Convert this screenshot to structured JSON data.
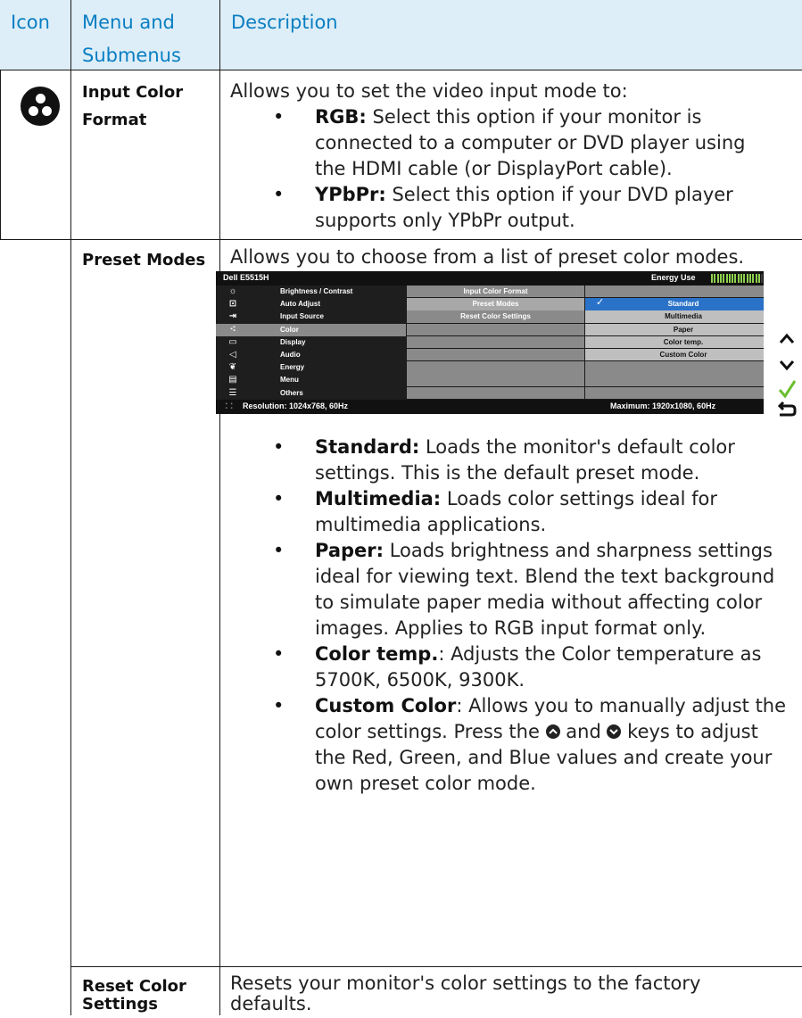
{
  "header": {
    "col_icon": "Icon",
    "col_menu_line1": "Menu and",
    "col_menu_line2": "Submenus",
    "col_desc": "Description"
  },
  "rows": {
    "input_color_format": {
      "label_line1": "Input Color",
      "label_line2": "Format",
      "intro": "Allows you to set the video input mode to:",
      "bullets": [
        {
          "term": "RGB:",
          "line1": " Select this option if your monitor is",
          "line2": "connected to a computer or DVD player using",
          "line3": "the HDMI cable (or DisplayPort cable)."
        },
        {
          "term": "YPbPr:",
          "line1": " Select this option if your DVD player",
          "line2": "supports only YPbPr output."
        }
      ]
    },
    "preset_modes": {
      "label": "Preset Modes",
      "intro": "Allows you to choose from a list of preset color modes.",
      "bullets": [
        {
          "term": "Standard:",
          "lines": [
            " Loads the monitor's default color",
            "settings. This is the default preset mode."
          ]
        },
        {
          "term": "Multimedia:",
          "lines": [
            " Loads color settings ideal for",
            "multimedia applications."
          ]
        },
        {
          "term": "Paper:",
          "lines": [
            " Loads brightness and sharpness settings",
            "ideal for viewing text. Blend the text background",
            "to simulate paper media without affecting color",
            "images. Applies to RGB input format only."
          ]
        },
        {
          "term": "Color temp.",
          "lines": [
            ": Adjusts the Color temperature as",
            "5700K, 6500K, 9300K."
          ]
        },
        {
          "term": "Custom Color",
          "lines": [
            ": Allows you to manually adjust the"
          ]
        }
      ],
      "custom_color_line2a": "color settings. Press the",
      "custom_color_line2b": "and",
      "custom_color_line2c": "keys to adjust",
      "custom_color_line3": "the Red, Green, and Blue values and create your",
      "custom_color_line4": "own preset color mode."
    },
    "reset_color_settings": {
      "label_line1": "Reset Color",
      "label_line2": "Settings",
      "desc_line1": "Resets your monitor's color settings to the factory",
      "desc_line2": "defaults."
    }
  },
  "osd": {
    "model": "Dell E5515H",
    "energy_label": "Energy Use",
    "energy_level": 0.75,
    "menu_items": [
      {
        "icon": "brightness-icon",
        "label": "Brightness / Contrast"
      },
      {
        "icon": "auto-adjust-icon",
        "label": "Auto Adjust"
      },
      {
        "icon": "input-source-icon",
        "label": "Input Source"
      },
      {
        "icon": "color-icon",
        "label": "Color"
      },
      {
        "icon": "display-icon",
        "label": "Display"
      },
      {
        "icon": "audio-icon",
        "label": "Audio"
      },
      {
        "icon": "energy-icon",
        "label": "Energy"
      },
      {
        "icon": "menu-icon",
        "label": "Menu"
      },
      {
        "icon": "others-icon",
        "label": "Others"
      }
    ],
    "submenu": [
      "Input Color Format",
      "Preset Modes",
      "Reset Color Settings"
    ],
    "options": [
      "Standard",
      "Multimedia",
      "Paper",
      "Color temp.",
      "Custom Color"
    ],
    "resolution": "Resolution: 1024x768, 60Hz",
    "maximum": "Maximum: 1920x1080, 60Hz",
    "selected_option": "Standard"
  },
  "colors": {
    "header_bg": "#ddeef8",
    "header_text": "#0a7ec2",
    "osd_highlight": "#2a72c8",
    "nav_check": "#6abf2e"
  }
}
